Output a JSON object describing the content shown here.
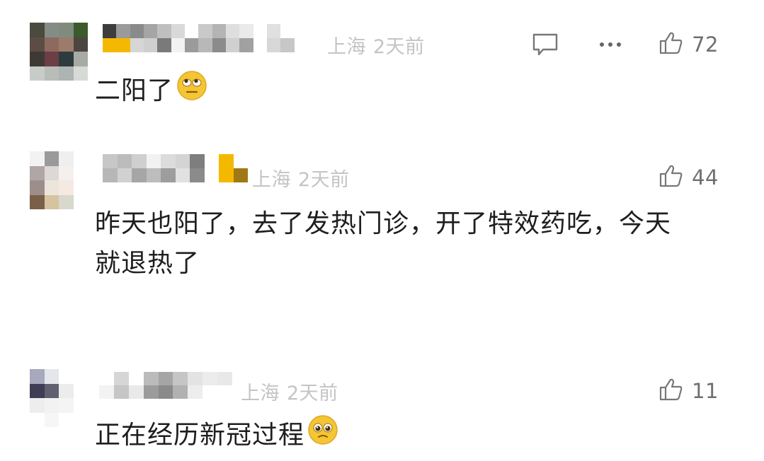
{
  "comments": [
    {
      "location": "上海",
      "time": "2天前",
      "text": "二阳了",
      "emoji": "face-with-rolling-eyes",
      "likes": "72",
      "has_reply_icon": true,
      "has_more_icon": true
    },
    {
      "location": "上海",
      "time": "2天前",
      "text_line1": "昨天也阳了，去了发热门诊，开了特效药吃，今天",
      "text_line2": "就退热了",
      "likes": "44"
    },
    {
      "location": "上海",
      "time": "2天前",
      "text": "正在经历新冠过程",
      "emoji": "pleading-face",
      "likes": "11"
    }
  ],
  "colors": {
    "meta_text": "#c4c4c4",
    "body_text": "#1e1e1e",
    "icon": "#777777",
    "badge": "#f5b800"
  },
  "icons": [
    "comment-bubble-icon",
    "more-dots-icon",
    "thumbs-up-icon"
  ]
}
